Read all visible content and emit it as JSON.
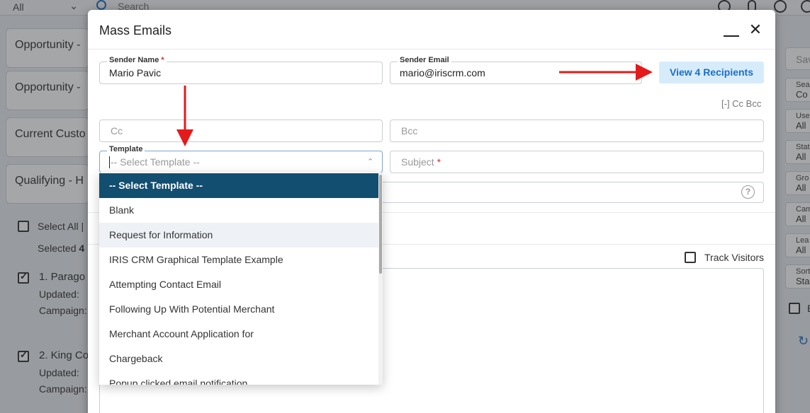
{
  "background": {
    "filter_value": "All",
    "search_placeholder": "Search",
    "cards": [
      "Opportunity -",
      "Opportunity -",
      "Current Custo",
      "Qualifying - H"
    ],
    "select_all": "Select All |",
    "selected_prefix": "Selected",
    "selected_count": "4",
    "records": [
      {
        "title": "1. Parago",
        "updated": "Updated:",
        "campaign": "Campaign:"
      },
      {
        "title": "2. King Co",
        "updated": "Updated:",
        "campaign": "Campaign:"
      }
    ],
    "right_panel": {
      "save": "Sav",
      "fields": [
        {
          "label": "Sea",
          "value": "Co"
        },
        {
          "label": "Use",
          "value": "All"
        },
        {
          "label": "Stat",
          "value": "All"
        },
        {
          "label": "Gro",
          "value": "All"
        },
        {
          "label": "Cam",
          "value": "All"
        },
        {
          "label": "Lea",
          "value": "All"
        },
        {
          "label": "Sort",
          "value": "Sta"
        }
      ],
      "checkbox_label": "E"
    }
  },
  "modal": {
    "title": "Mass Emails",
    "sender_name": {
      "label": "Sender Name",
      "required": "*",
      "value": "Mario Pavic"
    },
    "sender_email": {
      "label": "Sender Email",
      "value": "mario@iriscrm.com"
    },
    "view_recipients": "View 4 Recipients",
    "cc_bcc_toggle": "[-] Cc Bcc",
    "cc": {
      "placeholder": "Cc"
    },
    "bcc": {
      "placeholder": "Bcc"
    },
    "template": {
      "label": "Template",
      "placeholder": "-- Select Template --"
    },
    "subject": {
      "placeholder": "Subject",
      "required": "*"
    },
    "help_icon": "?",
    "track_visitors": "Track Visitors"
  },
  "template_dropdown": {
    "options": [
      "-- Select Template --",
      "Blank",
      "Request for Information",
      "IRIS CRM Graphical Template Example",
      "Attempting Contact Email",
      "Following Up With Potential Merchant",
      "Merchant Account Application for",
      "Chargeback",
      "Popup clicked email notification"
    ],
    "selected_index": 0,
    "hover_index": 2
  },
  "colors": {
    "accent": "#1b6fc9",
    "selected_option_bg": "#124e6f",
    "view_button_bg": "#d7ecfb",
    "annotation_arrow": "#e31b1b",
    "required": "#d32f2f"
  }
}
